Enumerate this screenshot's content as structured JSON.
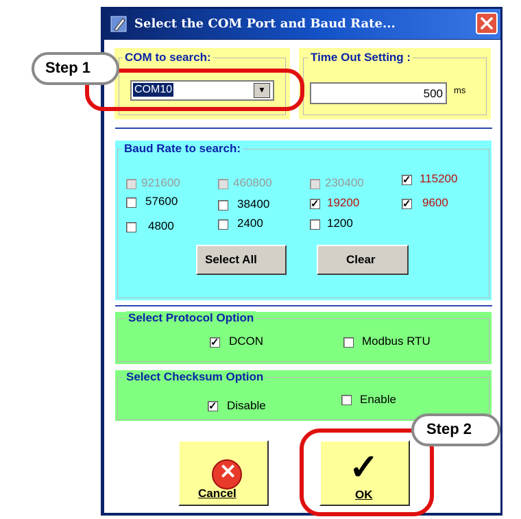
{
  "window": {
    "title": "Select the COM Port and Baud Rate...",
    "close_glyph": "✕",
    "icon": "pencil-icon"
  },
  "com": {
    "legend": "COM to search:",
    "selected": "COM10",
    "arrow_glyph": "▼"
  },
  "timeout": {
    "legend": "Time Out Setting :",
    "value": "500",
    "unit": "ms"
  },
  "baud": {
    "legend": "Baud Rate to search:",
    "options": [
      {
        "label": "921600",
        "checked": false,
        "enabled": false
      },
      {
        "label": "460800",
        "checked": false,
        "enabled": false
      },
      {
        "label": "230400",
        "checked": false,
        "enabled": false
      },
      {
        "label": "115200",
        "checked": true,
        "enabled": true
      },
      {
        "label": "57600",
        "checked": false,
        "enabled": true
      },
      {
        "label": "38400",
        "checked": false,
        "enabled": true
      },
      {
        "label": "19200",
        "checked": true,
        "enabled": true
      },
      {
        "label": "9600",
        "checked": true,
        "enabled": true
      },
      {
        "label": "4800",
        "checked": false,
        "enabled": true
      },
      {
        "label": "2400",
        "checked": false,
        "enabled": true
      },
      {
        "label": "1200",
        "checked": false,
        "enabled": true
      }
    ],
    "select_all_label": "Select  All",
    "clear_label": "Clear"
  },
  "protocol": {
    "legend": "Select Protocol Option",
    "options": [
      {
        "label": "DCON",
        "checked": true
      },
      {
        "label": "Modbus RTU",
        "checked": false
      }
    ]
  },
  "checksum": {
    "legend": "Select Checksum  Option",
    "options": [
      {
        "label": "Disable",
        "checked": true
      },
      {
        "label": "Enable",
        "checked": false
      }
    ]
  },
  "buttons": {
    "cancel_label": "Cancel",
    "ok_label": "OK",
    "ok_glyph": "✓",
    "cancel_glyph": "✕"
  },
  "callouts": {
    "step1": "Step 1",
    "step2": "Step 2"
  },
  "colors": {
    "legend_text": "#0b23a8",
    "checked_baud_text": "#b81010",
    "disabled_text": "#999999",
    "highlight_ring": "#e01010",
    "yellow_panel": "#ffff99",
    "cyan_panel": "#80ffff",
    "green_panel": "#80ff80"
  }
}
